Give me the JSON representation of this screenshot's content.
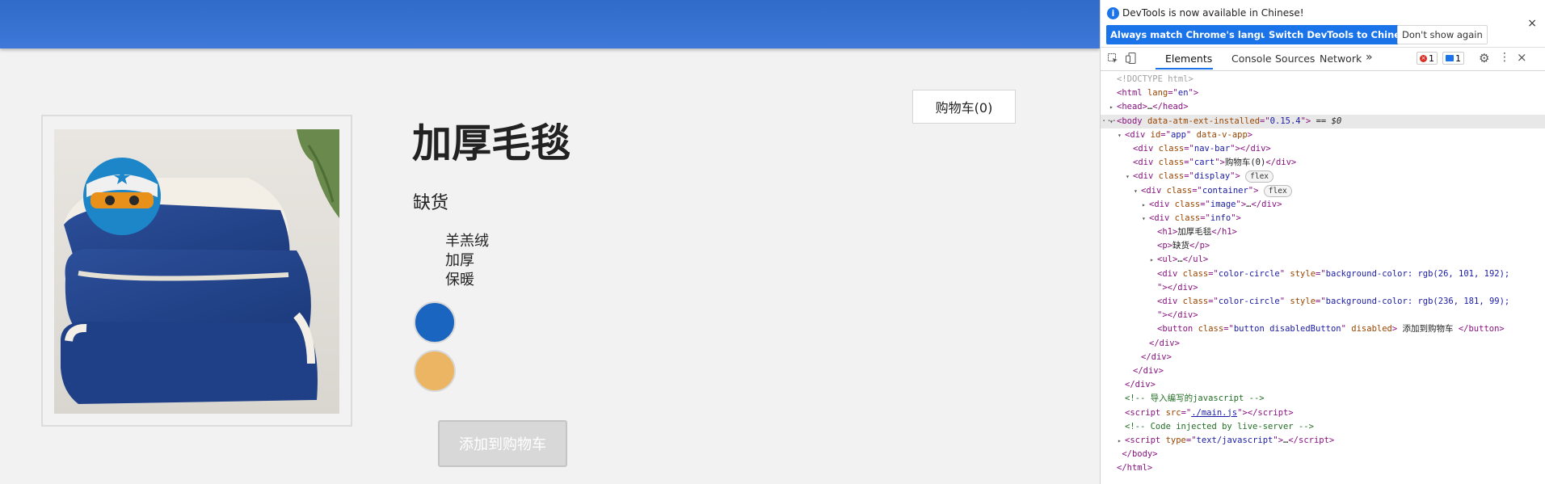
{
  "page": {
    "cart_label": "购物车(0)",
    "product_title": "加厚毛毯",
    "stock_status": "缺货",
    "features": [
      "羊羔绒",
      "加厚",
      "保暖"
    ],
    "color_options": [
      "#1a65c0",
      "#ecb563"
    ],
    "add_button_label": "添加到购物车",
    "image_semantic": "blue-fleece-blanket-with-ninja-mascot"
  },
  "devtools": {
    "notice_text": "DevTools is now available in Chinese!",
    "btn_match": "Always match Chrome's language",
    "btn_switch": "Switch DevTools to Chinese",
    "btn_dismiss": "Don't show again",
    "close_glyph": "×",
    "tabs": [
      "Elements",
      "Console",
      "Sources",
      "Network"
    ],
    "more_tabs": "»",
    "error_count": "1",
    "message_count": "1",
    "dom_tree": [
      {
        "indent": 0,
        "tri": "",
        "html": "<span class='doctype'>&lt;!DOCTYPE html&gt;</span>"
      },
      {
        "indent": 0,
        "tri": "",
        "html": "<span class='tag'>&lt;html</span> <span class='attr'>lang</span><span class='tag'>=\"</span><span class='val'>en</span><span class='tag'>\"&gt;</span>"
      },
      {
        "indent": 0,
        "tri": "▶",
        "html": "<span class='tag'>&lt;head&gt;</span>…<span class='tag'>&lt;/head&gt;</span>"
      },
      {
        "indent": 0,
        "tri": "▼",
        "sel": true,
        "pre": "···",
        "html": "<span class='tag'>&lt;body</span> <span class='attr'>data-atm-ext-installed</span><span class='tag'>=\"</span><span class='val'>0.15.4</span><span class='tag'>\"&gt;</span> == <i>$0</i>"
      },
      {
        "indent": 1,
        "tri": "▼",
        "html": "<span class='tag'>&lt;div</span> <span class='attr'>id</span><span class='tag'>=\"</span><span class='val'>app</span><span class='tag'>\"</span> <span class='attr'>data-v-app</span><span class='tag'>&gt;</span>"
      },
      {
        "indent": 2,
        "tri": "",
        "html": "<span class='tag'>&lt;div</span> <span class='attr'>class</span><span class='tag'>=\"</span><span class='val'>nav-bar</span><span class='tag'>\"&gt;&lt;/div&gt;</span>"
      },
      {
        "indent": 2,
        "tri": "",
        "html": "<span class='tag'>&lt;div</span> <span class='attr'>class</span><span class='tag'>=\"</span><span class='val'>cart</span><span class='tag'>\"&gt;</span>购物车(0)<span class='tag'>&lt;/div&gt;</span>"
      },
      {
        "indent": 2,
        "tri": "▼",
        "html": "<span class='tag'>&lt;div</span> <span class='attr'>class</span><span class='tag'>=\"</span><span class='val'>display</span><span class='tag'>\"&gt;</span> <span class='flexbadge'>flex</span>"
      },
      {
        "indent": 3,
        "tri": "▼",
        "html": "<span class='tag'>&lt;div</span> <span class='attr'>class</span><span class='tag'>=\"</span><span class='val'>container</span><span class='tag'>\"&gt;</span> <span class='flexbadge'>flex</span>"
      },
      {
        "indent": 4,
        "tri": "▶",
        "html": "<span class='tag'>&lt;div</span> <span class='attr'>class</span><span class='tag'>=\"</span><span class='val'>image</span><span class='tag'>\"&gt;</span>…<span class='tag'>&lt;/div&gt;</span>"
      },
      {
        "indent": 4,
        "tri": "▼",
        "html": "<span class='tag'>&lt;div</span> <span class='attr'>class</span><span class='tag'>=\"</span><span class='val'>info</span><span class='tag'>\"&gt;</span>"
      },
      {
        "indent": 5,
        "tri": "",
        "html": "<span class='tag'>&lt;h1&gt;</span>加厚毛毯<span class='tag'>&lt;/h1&gt;</span>"
      },
      {
        "indent": 5,
        "tri": "",
        "html": "<span class='tag'>&lt;p&gt;</span>缺货<span class='tag'>&lt;/p&gt;</span>"
      },
      {
        "indent": 5,
        "tri": "▶",
        "html": "<span class='tag'>&lt;ul&gt;</span>…<span class='tag'>&lt;/ul&gt;</span>"
      },
      {
        "indent": 5,
        "tri": "",
        "html": "<span class='tag'>&lt;div</span> <span class='attr'>class</span><span class='tag'>=\"</span><span class='val'>color-circle</span><span class='tag'>\"</span> <span class='attr'>style</span><span class='tag'>=\"</span><span class='val'>background-color: rgb(26, 101, 192);</span>"
      },
      {
        "indent": 5,
        "tri": "",
        "html": "<span class='tag'>\"&gt;&lt;/div&gt;</span>"
      },
      {
        "indent": 5,
        "tri": "",
        "html": "<span class='tag'>&lt;div</span> <span class='attr'>class</span><span class='tag'>=\"</span><span class='val'>color-circle</span><span class='tag'>\"</span> <span class='attr'>style</span><span class='tag'>=\"</span><span class='val'>background-color: rgb(236, 181, 99);</span>"
      },
      {
        "indent": 5,
        "tri": "",
        "html": "<span class='tag'>\"&gt;&lt;/div&gt;</span>"
      },
      {
        "indent": 5,
        "tri": "",
        "html": "<span class='tag'>&lt;button</span> <span class='attr'>class</span><span class='tag'>=\"</span><span class='val'>button disabledButton</span><span class='tag'>\"</span> <span class='attr'>disabled</span><span class='tag'>&gt;</span> 添加到购物车 <span class='tag'>&lt;/button&gt;</span>"
      },
      {
        "indent": 4,
        "tri": "",
        "html": "<span class='tag'>&lt;/div&gt;</span>"
      },
      {
        "indent": 3,
        "tri": "",
        "html": "<span class='tag'>&lt;/div&gt;</span>"
      },
      {
        "indent": 2,
        "tri": "",
        "html": "<span class='tag'>&lt;/div&gt;</span>"
      },
      {
        "indent": 1,
        "tri": "",
        "html": "<span class='tag'>&lt;/div&gt;</span>"
      },
      {
        "indent": 1,
        "tri": "",
        "html": "<span class='comment'>&lt;!-- 导入编写的javascript --&gt;</span>"
      },
      {
        "indent": 1,
        "tri": "",
        "html": "<span class='tag'>&lt;script</span> <span class='attr'>src</span><span class='tag'>=\"</span><span class='link'>./main.js</span><span class='tag'>\"&gt;&lt;/script&gt;</span>"
      },
      {
        "indent": 1,
        "tri": "",
        "html": "<span class='comment'>&lt;!-- Code injected by live-server --&gt;</span>"
      },
      {
        "indent": 1,
        "tri": "▶",
        "html": "<span class='tag'>&lt;script</span> <span class='attr'>type</span><span class='tag'>=\"</span><span class='val'>text/javascript</span><span class='tag'>\"&gt;</span>…<span class='tag'>&lt;/script&gt;</span>"
      },
      {
        "indent": 0,
        "tri": "",
        "html": "<span class='tag'>&nbsp;&lt;/body&gt;</span>"
      },
      {
        "indent": 0,
        "tri": "",
        "html": "<span class='tag'>&lt;/html&gt;</span>"
      }
    ]
  }
}
